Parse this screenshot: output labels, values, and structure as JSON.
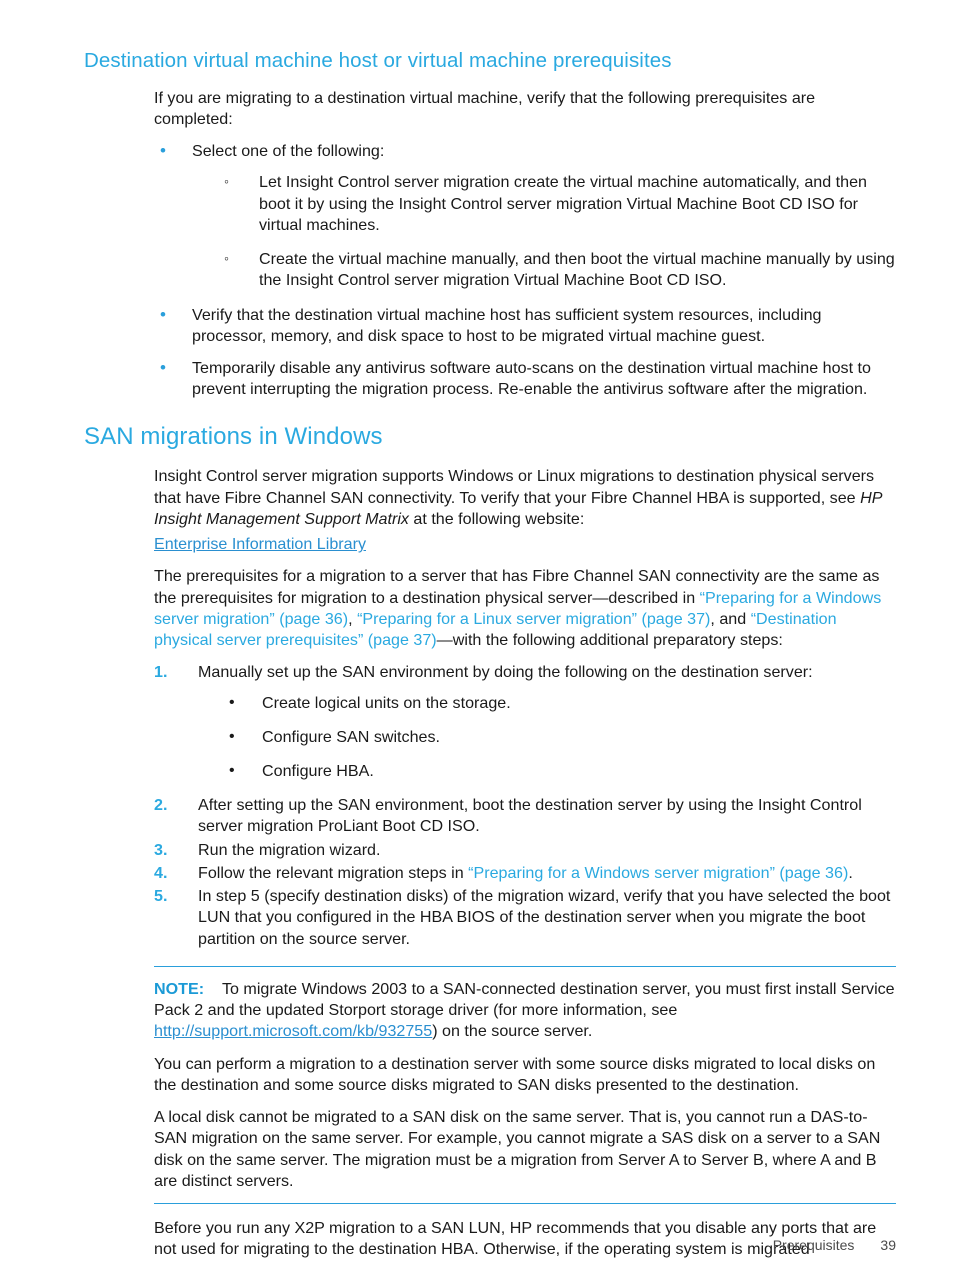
{
  "page": {
    "footer_section": "Prerequisites",
    "footer_page_number": "39"
  },
  "colors": {
    "heading": "#2aa9e0",
    "link": "#2aa9e0",
    "external_link": "#2a8fd0",
    "bullet": "#2a9fdb",
    "note_rule": "#2a9fdb",
    "body_text": "#1a1a1a"
  },
  "section_vm": {
    "heading": "Destination virtual machine host or virtual machine prerequisites",
    "intro": "If you are migrating to a destination virtual machine, verify that the following prerequisites are completed:",
    "bullet_select": "Select one of the following:",
    "sub_bullets": [
      "Let Insight Control server migration create the virtual machine automatically, and then boot it by using the Insight Control server migration Virtual Machine Boot CD ISO for virtual machines.",
      "Create the virtual machine manually, and then boot the virtual machine manually by using the Insight Control server migration Virtual Machine Boot CD ISO."
    ],
    "bullets": [
      "Verify that the destination virtual machine host has sufficient system resources, including processor, memory, and disk space to host to be migrated virtual machine guest.",
      "Temporarily disable any antivirus software auto-scans on the destination virtual machine host to prevent interrupting the migration process. Re-enable the antivirus software after the migration."
    ]
  },
  "section_san": {
    "heading": "SAN migrations in Windows",
    "para1_part1": "Insight Control server migration supports Windows or Linux migrations to destination physical servers that have Fibre Channel SAN connectivity. To verify that your Fibre Channel HBA is supported, see ",
    "para1_italic": "HP Insight Management Support Matrix",
    "para1_part2": " at the following website:",
    "library_link": "Enterprise Information Library",
    "para2_part1": "The prerequisites for a migration to a server that has Fibre Channel SAN connectivity are the same as the prerequisites for migration to a destination physical server—described in ",
    "para2_link1": "“Preparing for a Windows server migration” (page 36)",
    "para2_sep1": ", ",
    "para2_link2": "“Preparing for a Linux server migration” (page 37)",
    "para2_sep2": ", and ",
    "para2_link3": "“Destination physical server prerequisites” (page 37)",
    "para2_part2": "—with the following additional preparatory steps:",
    "steps": {
      "step1": "Manually set up the SAN environment by doing the following on the destination server:",
      "step1_sub": [
        "Create logical units on the storage.",
        "Configure SAN switches.",
        "Configure HBA."
      ],
      "step2": "After setting up the SAN environment, boot the destination server by using the Insight Control server migration ProLiant Boot CD ISO.",
      "step3": "Run the migration wizard.",
      "step4_part1": "Follow the relevant migration steps in ",
      "step4_link": "“Preparing for a Windows server migration” (page 36)",
      "step4_part2": ".",
      "step5": "In step 5 (specify destination disks) of the migration wizard, verify that you have selected the boot LUN that you configured in the HBA BIOS of the destination server when you migrate the boot partition on the source server."
    },
    "note": {
      "label": "NOTE:",
      "text_part1": "To migrate Windows 2003 to a SAN-connected destination server, you must first install Service Pack 2 and the updated Storport storage driver (for more information, see ",
      "url_link": "http://support.microsoft.com/kb/932755",
      "text_part2": ") on the source server.",
      "para2": "You can perform a migration to a destination server with some source disks migrated to local disks on the destination and some source disks migrated to SAN disks presented to the destination.",
      "para3": "A local disk cannot be migrated to a SAN disk on the same server. That is, you cannot run a DAS-to-SAN migration on the same server. For example, you cannot migrate a SAS disk on a server to a SAN disk on the same server. The migration must be a migration from Server A to Server B, where A and B are distinct servers."
    },
    "closing_para": "Before you run any X2P migration to a SAN LUN, HP recommends that you disable any ports that are not used for migrating to the destination HBA. Otherwise, if the operating system is migrated"
  }
}
